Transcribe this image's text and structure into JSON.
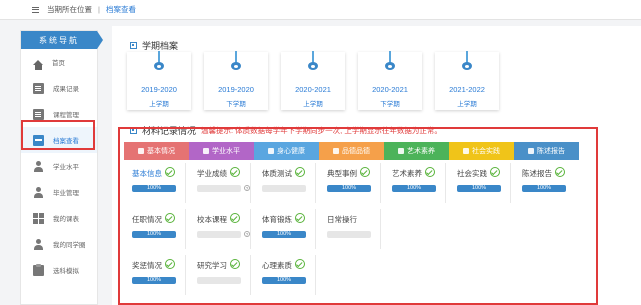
{
  "breadcrumb": {
    "prefix": "当期所在位置",
    "separator": "|",
    "current": "档案查看"
  },
  "sidebar": {
    "title": "系统导航",
    "items": [
      {
        "label": "首页",
        "icon": "home-icon"
      },
      {
        "label": "成果记录",
        "icon": "edit-icon"
      },
      {
        "label": "课程管理",
        "icon": "course-icon"
      },
      {
        "label": "档案查看",
        "icon": "archive-icon",
        "active": true
      },
      {
        "label": "学业水平",
        "icon": "user-icon"
      },
      {
        "label": "毕业管理",
        "icon": "user-icon"
      },
      {
        "label": "我的课表",
        "icon": "schedule-icon"
      },
      {
        "label": "我的同学圈",
        "icon": "user-icon"
      },
      {
        "label": "选科模拟",
        "icon": "clipboard-icon"
      }
    ]
  },
  "archive": {
    "title": "学期档案",
    "terms": [
      {
        "year": "2019-2020",
        "half": "上学期"
      },
      {
        "year": "2019-2020",
        "half": "下学期"
      },
      {
        "year": "2020-2021",
        "half": "上学期"
      },
      {
        "year": "2020-2021",
        "half": "下学期"
      },
      {
        "year": "2021-2022",
        "half": "上学期"
      }
    ]
  },
  "records": {
    "title": "材料记录情况",
    "tip": "温馨提示: 体质数据每学年下学期同步一次, 上学期显示往年数据为正常。",
    "tabs": [
      {
        "label": "基本情况",
        "color": "#e57373"
      },
      {
        "label": "学业水平",
        "color": "#b266c7"
      },
      {
        "label": "身心健康",
        "color": "#5aa6e0"
      },
      {
        "label": "品德品德",
        "color": "#f5a04a"
      },
      {
        "label": "艺术素养",
        "color": "#4cb35a"
      },
      {
        "label": "社会实践",
        "color": "#f0c419"
      },
      {
        "label": "陈述报告",
        "color": "#4a90c8"
      }
    ],
    "cells": [
      {
        "name": "基本信息",
        "checked": true,
        "progress": "100%",
        "highlight": true,
        "help": false
      },
      {
        "name": "学业成绩",
        "checked": true,
        "progress": "",
        "highlight": false,
        "help": true
      },
      {
        "name": "体质测试",
        "checked": true,
        "progress": "",
        "highlight": false,
        "help": false
      },
      {
        "name": "典型事例",
        "checked": true,
        "progress": "100%",
        "highlight": false,
        "help": false
      },
      {
        "name": "艺术素养",
        "checked": true,
        "progress": "100%",
        "highlight": false,
        "help": false
      },
      {
        "name": "社会实践",
        "checked": true,
        "progress": "100%",
        "highlight": false,
        "help": false
      },
      {
        "name": "陈述报告",
        "checked": true,
        "progress": "100%",
        "highlight": false,
        "help": false
      },
      {
        "name": "任职情况",
        "checked": true,
        "progress": "100%",
        "highlight": false,
        "help": false
      },
      {
        "name": "校本课程",
        "checked": true,
        "progress": "",
        "highlight": false,
        "help": true
      },
      {
        "name": "体育锻炼",
        "checked": true,
        "progress": "100%",
        "highlight": false,
        "help": false
      },
      {
        "name": "日常操行",
        "checked": false,
        "progress": "",
        "highlight": false,
        "help": false
      },
      {
        "name": "奖惩情况",
        "checked": true,
        "progress": "100%",
        "highlight": false,
        "help": false
      },
      {
        "name": "研究学习",
        "checked": true,
        "progress": "",
        "highlight": false,
        "help": false
      },
      {
        "name": "心理素质",
        "checked": true,
        "progress": "100%",
        "highlight": false,
        "help": false
      }
    ]
  }
}
